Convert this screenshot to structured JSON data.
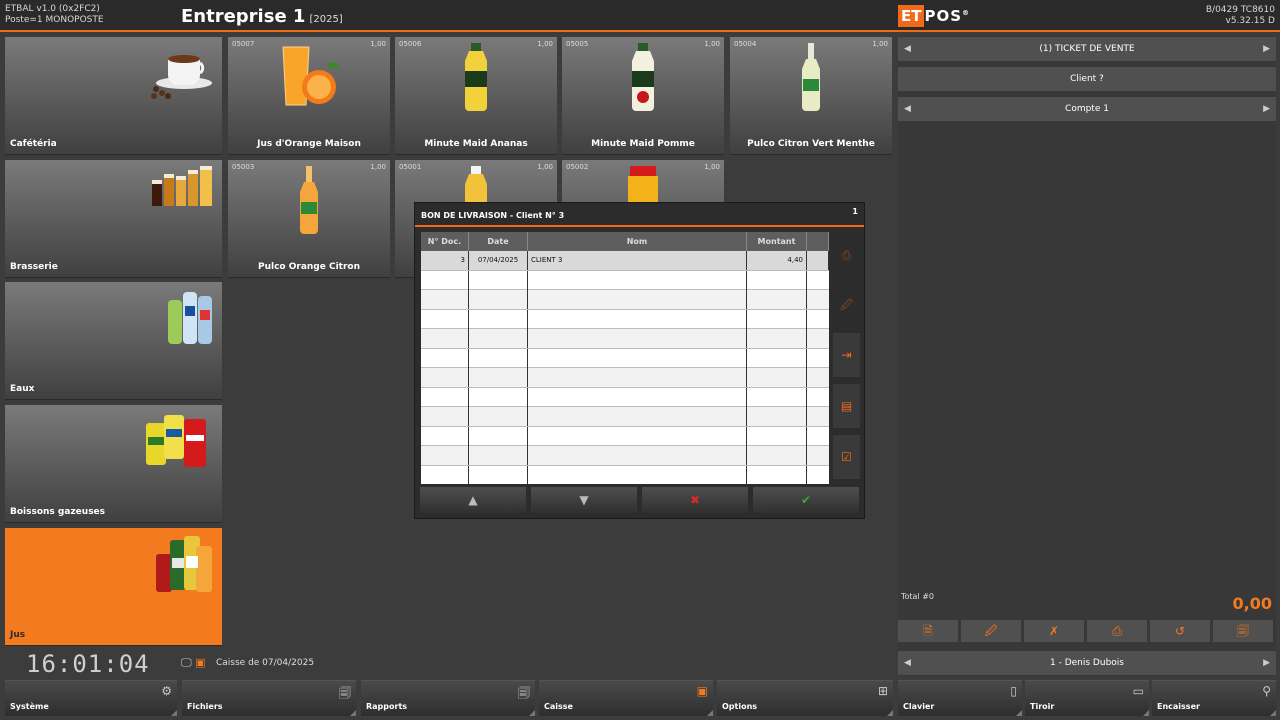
{
  "header": {
    "app_name": "ETBAL v1.0 (0x2FC2)",
    "poste": "Poste=1 MONOPOSTE",
    "title": "Entreprise 1",
    "year": "[2025]",
    "logo_et": "ET",
    "logo_pos": "POS",
    "logo_reg": "®",
    "build": "B/0429 TC8610",
    "version": "v5.32.15 D"
  },
  "categories": [
    {
      "label": "Cafétéria",
      "icon": "coffee-cup-icon"
    },
    {
      "label": "Brasserie",
      "icon": "beer-glasses-icon"
    },
    {
      "label": "Eaux",
      "icon": "water-bottles-icon"
    },
    {
      "label": "Boissons gazeuses",
      "icon": "soda-cans-icon"
    },
    {
      "label": "Jus",
      "icon": "juice-bottles-icon"
    }
  ],
  "products": [
    {
      "code": "05007",
      "qty": "1,00",
      "label": "Jus d'Orange Maison"
    },
    {
      "code": "05006",
      "qty": "1,00",
      "label": "Minute Maid Ananas"
    },
    {
      "code": "05005",
      "qty": "1,00",
      "label": "Minute Maid Pomme"
    },
    {
      "code": "05004",
      "qty": "1,00",
      "label": "Pulco Citron Vert Menthe"
    },
    {
      "code": "05003",
      "qty": "1,00",
      "label": "Pulco Orange Citron"
    },
    {
      "code": "05001",
      "qty": "1,00",
      "label": ""
    },
    {
      "code": "05002",
      "qty": "1,00",
      "label": ""
    }
  ],
  "clock": "16:01:04",
  "caisse_label": "Caisse de 07/04/2025",
  "footer": [
    {
      "label": "Système",
      "icon": "gear-icon"
    },
    {
      "label": "Fichiers",
      "icon": "files-icon"
    },
    {
      "label": "Rapports",
      "icon": "reports-icon"
    },
    {
      "label": "Caisse",
      "icon": "register-icon"
    },
    {
      "label": "Options",
      "icon": "grid-icon"
    },
    {
      "label": "Clavier",
      "icon": "keyboard-icon"
    },
    {
      "label": "Tiroir",
      "icon": "drawer-icon"
    },
    {
      "label": "Encaisser",
      "icon": "cashier-icon"
    }
  ],
  "ticket": {
    "title": "(1) TICKET DE VENTE",
    "client": "Client ?",
    "compte": "Compte 1",
    "total_label": "Total #0",
    "total_amount": "0,00",
    "operator": "1 - Denis Dubois"
  },
  "dialog": {
    "title": "BON DE LIVRAISON - Client N° 3",
    "page": "1",
    "columns": [
      "N° Doc.",
      "Date",
      "Nom",
      "Montant"
    ],
    "rows": [
      {
        "doc": "3",
        "date": "07/04/2025",
        "nom": "CLIENT 3",
        "montant": "4,40"
      }
    ]
  },
  "colors": {
    "accent": "#f06a1a",
    "active_category": "#f47a1f",
    "background": "#3c3c3c"
  }
}
